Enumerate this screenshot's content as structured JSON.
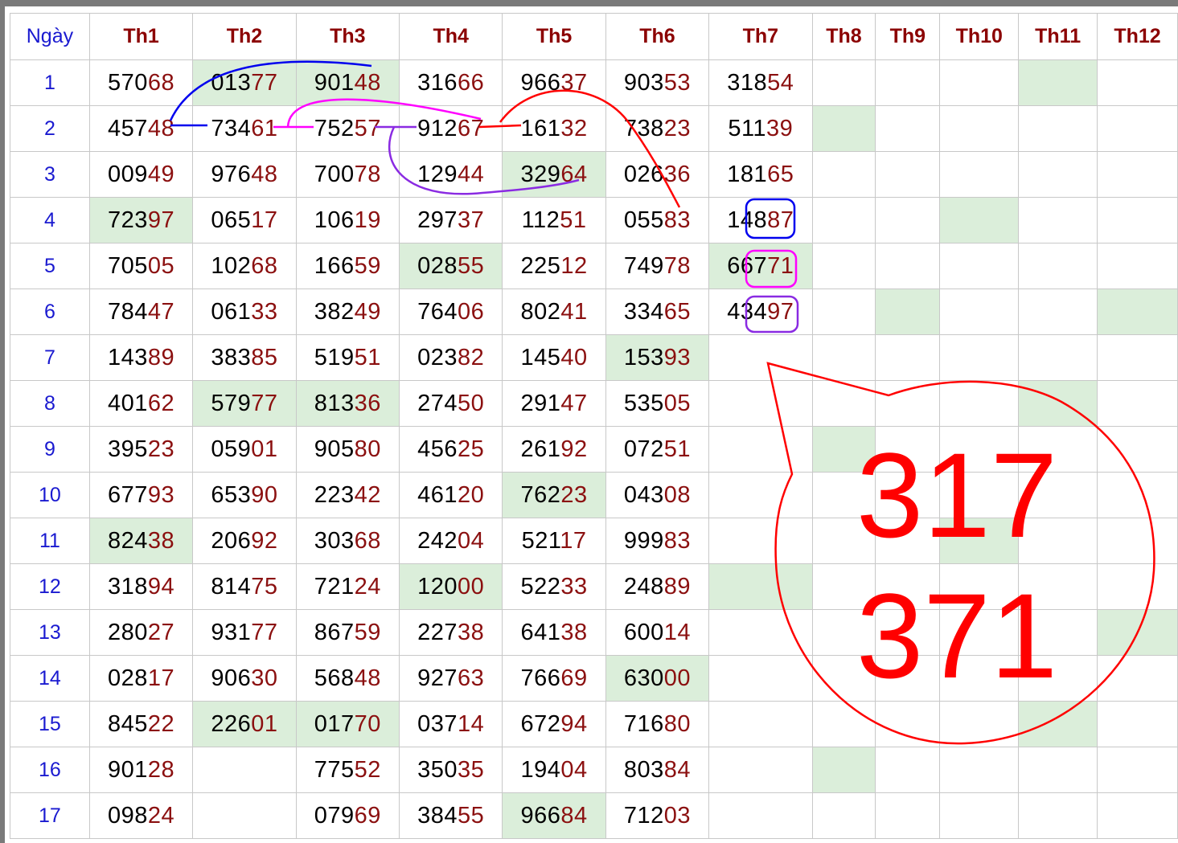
{
  "headers": [
    "Ngày",
    "Th1",
    "Th2",
    "Th3",
    "Th4",
    "Th5",
    "Th6",
    "Th7",
    "Th8",
    "Th9",
    "Th10",
    "Th11",
    "Th12"
  ],
  "rows": [
    {
      "day": "1",
      "cells": [
        "57068",
        "01377",
        "90148",
        "31666",
        "96637",
        "90353",
        "31854",
        "",
        "",
        "",
        "",
        ""
      ]
    },
    {
      "day": "2",
      "cells": [
        "45748",
        "73461",
        "75257",
        "91267",
        "16132",
        "73823",
        "51139",
        "",
        "",
        "",
        "",
        ""
      ]
    },
    {
      "day": "3",
      "cells": [
        "00949",
        "97648",
        "70078",
        "12944",
        "32964",
        "02636",
        "18165",
        "",
        "",
        "",
        "",
        ""
      ]
    },
    {
      "day": "4",
      "cells": [
        "72397",
        "06517",
        "10619",
        "29737",
        "11251",
        "05583",
        "14887",
        "",
        "",
        "",
        "",
        ""
      ]
    },
    {
      "day": "5",
      "cells": [
        "70505",
        "10268",
        "16659",
        "02855",
        "22512",
        "74978",
        "66771",
        "",
        "",
        "",
        "",
        ""
      ]
    },
    {
      "day": "6",
      "cells": [
        "78447",
        "06133",
        "38249",
        "76406",
        "80241",
        "33465",
        "43497",
        "",
        "",
        "",
        "",
        ""
      ]
    },
    {
      "day": "7",
      "cells": [
        "14389",
        "38385",
        "51951",
        "02382",
        "14540",
        "15393",
        "",
        "",
        "",
        "",
        "",
        ""
      ]
    },
    {
      "day": "8",
      "cells": [
        "40162",
        "57977",
        "81336",
        "27450",
        "29147",
        "53505",
        "",
        "",
        "",
        "",
        "",
        ""
      ]
    },
    {
      "day": "9",
      "cells": [
        "39523",
        "05901",
        "90580",
        "45625",
        "26192",
        "07251",
        "",
        "",
        "",
        "",
        "",
        ""
      ]
    },
    {
      "day": "10",
      "cells": [
        "67793",
        "65390",
        "22342",
        "46120",
        "76223",
        "04308",
        "",
        "",
        "",
        "",
        "",
        ""
      ]
    },
    {
      "day": "11",
      "cells": [
        "82438",
        "20692",
        "30368",
        "24204",
        "52117",
        "99983",
        "",
        "",
        "",
        "",
        "",
        ""
      ]
    },
    {
      "day": "12",
      "cells": [
        "31894",
        "81475",
        "72124",
        "12000",
        "52233",
        "24889",
        "",
        "",
        "",
        "",
        "",
        ""
      ]
    },
    {
      "day": "13",
      "cells": [
        "28027",
        "93177",
        "86759",
        "22738",
        "64138",
        "60014",
        "",
        "",
        "",
        "",
        "",
        ""
      ]
    },
    {
      "day": "14",
      "cells": [
        "02817",
        "90630",
        "56848",
        "92763",
        "76669",
        "63000",
        "",
        "",
        "",
        "",
        "",
        ""
      ]
    },
    {
      "day": "15",
      "cells": [
        "84522",
        "22601",
        "01770",
        "03714",
        "67294",
        "71680",
        "",
        "",
        "",
        "",
        "",
        ""
      ]
    },
    {
      "day": "16",
      "cells": [
        "90128",
        "",
        "77552",
        "35035",
        "19404",
        "80384",
        "",
        "",
        "",
        "",
        "",
        ""
      ]
    },
    {
      "day": "17",
      "cells": [
        "09824",
        "",
        "07969",
        "38455",
        "96684",
        "71203",
        "",
        "",
        "",
        "",
        "",
        ""
      ]
    }
  ],
  "highlights": [
    [
      1,
      2
    ],
    [
      1,
      3
    ],
    [
      1,
      11
    ],
    [
      2,
      8
    ],
    [
      3,
      5
    ],
    [
      4,
      1
    ],
    [
      4,
      10
    ],
    [
      5,
      4
    ],
    [
      5,
      7
    ],
    [
      6,
      9
    ],
    [
      6,
      12
    ],
    [
      7,
      6
    ],
    [
      8,
      2
    ],
    [
      8,
      3
    ],
    [
      8,
      11
    ],
    [
      9,
      8
    ],
    [
      10,
      5
    ],
    [
      11,
      1
    ],
    [
      11,
      10
    ],
    [
      12,
      4
    ],
    [
      12,
      7
    ],
    [
      13,
      12
    ],
    [
      14,
      6
    ],
    [
      15,
      2
    ],
    [
      15,
      3
    ],
    [
      15,
      11
    ],
    [
      16,
      8
    ],
    [
      17,
      5
    ]
  ],
  "callout": {
    "line1": "317",
    "line2": "371"
  },
  "colors": {
    "day_blue": "#1a1ad0",
    "month_red": "#8b0000",
    "highlight_green": "#dbeeda",
    "blue_line": "#0000ee",
    "magenta_line": "#ff00ff",
    "purple_line": "#8a2be2",
    "red_line": "#ff0000"
  }
}
